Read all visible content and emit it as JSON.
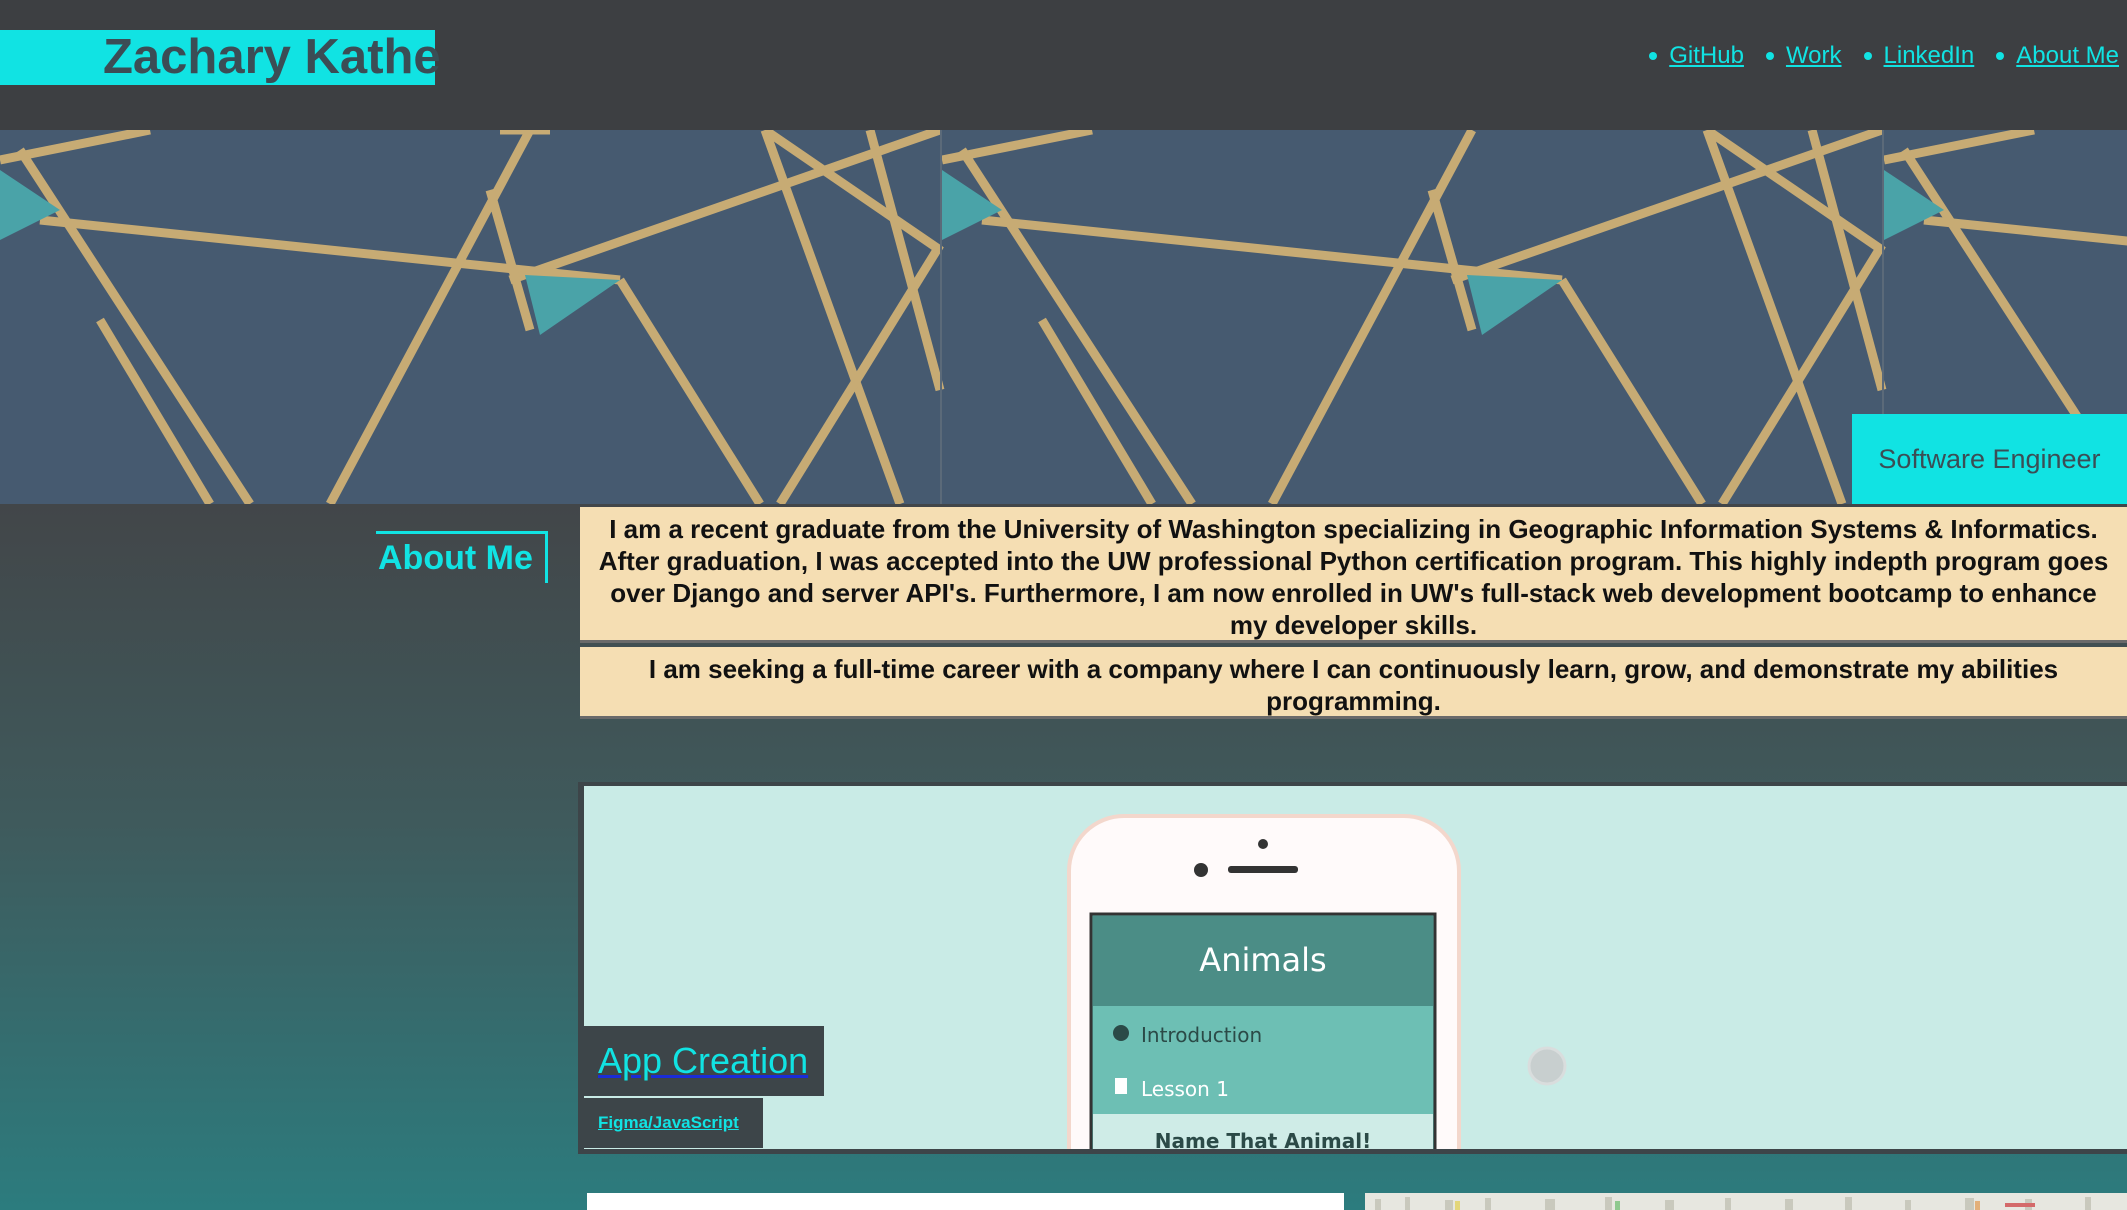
{
  "header": {
    "name": "Zachary Kathe",
    "nav": [
      {
        "label": "GitHub"
      },
      {
        "label": "Work"
      },
      {
        "label": "LinkedIn"
      },
      {
        "label": "About Me"
      }
    ]
  },
  "hero": {
    "role": "Software Engineer"
  },
  "about": {
    "heading": "About Me",
    "paragraphs": [
      "I am a recent graduate from the University of Washington specializing in Geographic Information Systems & Informatics. After graduation, I was accepted into the UW professional Python certification program. This highly indepth program goes over Django and server API's. Furthermore, I am now enrolled in UW's full-stack web development bootcamp to enhance my developer skills.",
      "I am seeking a full-time career with a company where I can continuously learn, grow, and demonstrate my abilities programming."
    ]
  },
  "projects": [
    {
      "title": "App Creation",
      "tech": "Figma/JavaScript",
      "screen": {
        "header": "Animals",
        "items": [
          "Introduction",
          "Lesson 1",
          "Name That Animal!"
        ]
      }
    }
  ],
  "colors": {
    "accent": "#11e3e3",
    "header_bg": "#3d3f42",
    "paragraph_bg": "#f5deb3"
  }
}
